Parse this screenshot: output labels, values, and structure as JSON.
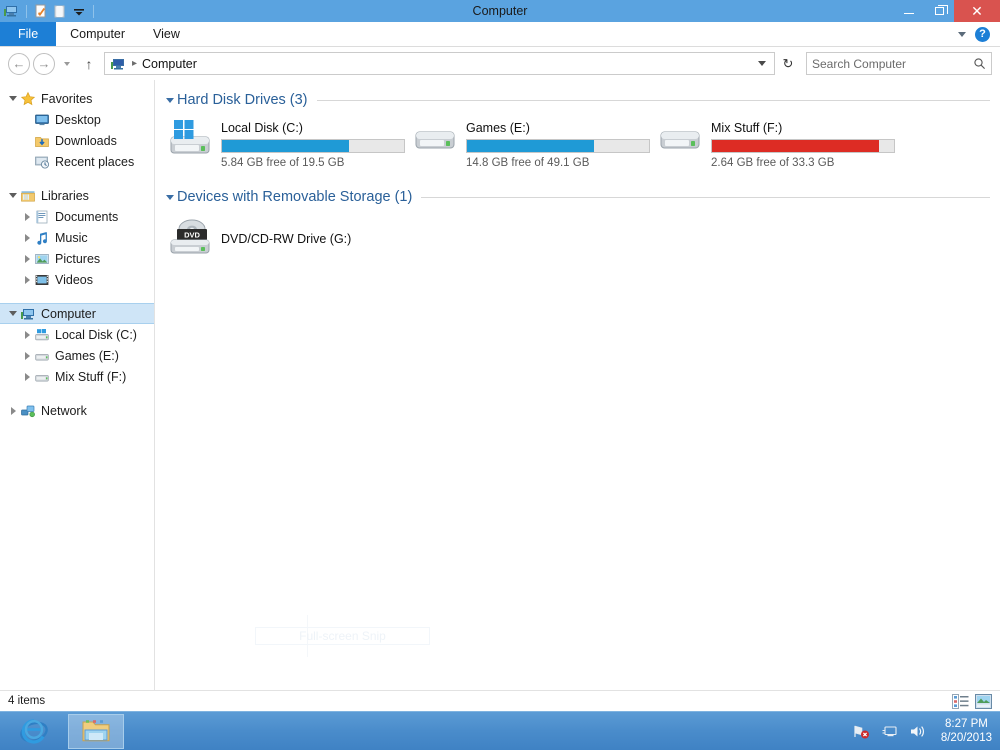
{
  "window": {
    "title": "Computer",
    "quick_access": [
      "computer-icon",
      "properties-icon",
      "new-folder-icon",
      "customize-dropdown-icon"
    ],
    "controls": {
      "minimize": "minimize-button",
      "maximize": "maximize-button",
      "close": "close-button"
    }
  },
  "ribbon": {
    "tabs": [
      {
        "label": "File",
        "active_style": "file"
      },
      {
        "label": "Computer",
        "active_style": "normal"
      },
      {
        "label": "View",
        "active_style": "normal"
      }
    ],
    "expand_label": "chevron-down-icon",
    "help_label": "?"
  },
  "addressbar": {
    "back": "←",
    "forward": "→",
    "up": "↑",
    "breadcrumb": "Computer",
    "refresh": "↻",
    "separator": "▸"
  },
  "search": {
    "placeholder": "Search Computer",
    "value": "",
    "icon": "search-icon"
  },
  "sidebar": {
    "sections": [
      {
        "name": "Favorites",
        "icon": "star-icon",
        "expanded": true,
        "items": [
          {
            "label": "Desktop",
            "icon": "desktop-icon",
            "twisty": "none"
          },
          {
            "label": "Downloads",
            "icon": "downloads-icon",
            "twisty": "none"
          },
          {
            "label": "Recent places",
            "icon": "recent-places-icon",
            "twisty": "none"
          }
        ]
      },
      {
        "name": "Libraries",
        "icon": "libraries-icon",
        "expanded": true,
        "items": [
          {
            "label": "Documents",
            "icon": "documents-icon",
            "twisty": "collapsed"
          },
          {
            "label": "Music",
            "icon": "music-icon",
            "twisty": "collapsed"
          },
          {
            "label": "Pictures",
            "icon": "pictures-icon",
            "twisty": "collapsed"
          },
          {
            "label": "Videos",
            "icon": "videos-icon",
            "twisty": "collapsed"
          }
        ]
      },
      {
        "name": "Computer",
        "icon": "computer-icon",
        "expanded": true,
        "selected": true,
        "items": [
          {
            "label": "Local Disk (C:)",
            "icon": "system-drive-icon",
            "twisty": "collapsed"
          },
          {
            "label": "Games (E:)",
            "icon": "drive-icon",
            "twisty": "collapsed"
          },
          {
            "label": "Mix Stuff (F:)",
            "icon": "drive-icon",
            "twisty": "collapsed"
          }
        ]
      },
      {
        "name": "Network",
        "icon": "network-icon",
        "expanded": false,
        "items": []
      }
    ]
  },
  "content": {
    "groups": [
      {
        "title": "Hard Disk Drives (3)",
        "kind": "drives",
        "drives": [
          {
            "name": "Local Disk (C:)",
            "free_text": "5.84 GB free of 19.5 GB",
            "free_gb": 5.84,
            "total_gb": 19.5,
            "used_percent": 70,
            "bar_color": "#1f9ad6",
            "icon": "system-drive-icon"
          },
          {
            "name": "Games (E:)",
            "free_text": "14.8 GB free of 49.1 GB",
            "free_gb": 14.8,
            "total_gb": 49.1,
            "used_percent": 70,
            "bar_color": "#1f9ad6",
            "icon": "drive-icon"
          },
          {
            "name": "Mix Stuff (F:)",
            "free_text": "2.64 GB free of 33.3 GB",
            "free_gb": 2.64,
            "total_gb": 33.3,
            "used_percent": 92,
            "bar_color": "#dd2c24",
            "icon": "drive-icon"
          }
        ]
      },
      {
        "title": "Devices with Removable Storage (1)",
        "kind": "optical",
        "devices": [
          {
            "name": "DVD/CD-RW Drive (G:)",
            "icon": "dvd-drive-icon",
            "badge": "DVD"
          }
        ]
      }
    ],
    "ghost_overlay": "Full-screen Snip"
  },
  "statusbar": {
    "item_count": "4 items",
    "views": [
      {
        "name": "details-view-button",
        "active": false
      },
      {
        "name": "large-icons-view-button",
        "active": true
      }
    ]
  },
  "taskbar": {
    "buttons": [
      {
        "name": "internet-explorer",
        "active": false
      },
      {
        "name": "file-explorer",
        "active": true
      }
    ],
    "tray": [
      "network-disconnected-icon",
      "action-center-icon",
      "volume-icon"
    ],
    "time": "8:27 PM",
    "date": "8/20/2013"
  },
  "colors": {
    "titlebar": "#5aa3e0",
    "accent_blue": "#1d7fd6",
    "bar_blue": "#1f9ad6",
    "bar_red": "#dd2c24",
    "group_heading": "#2a6099",
    "selection": "#cfe5f7",
    "close_red": "#d9534f"
  }
}
